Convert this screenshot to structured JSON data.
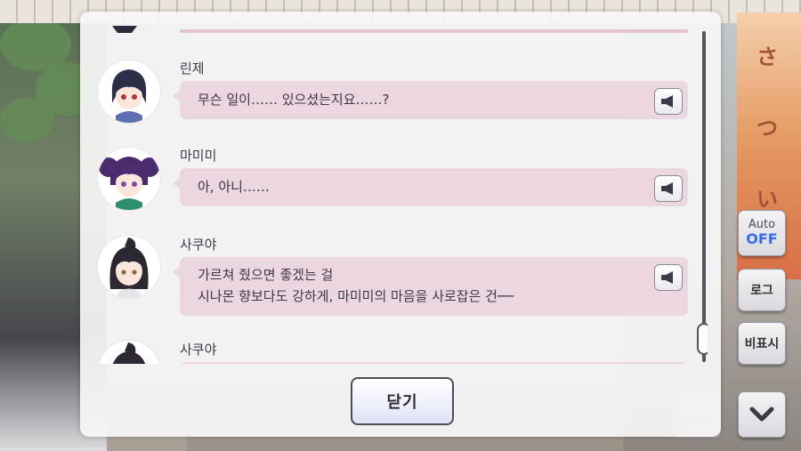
{
  "log": {
    "entries": [
      {
        "speaker": "린제",
        "lines": [
          "무슨 일이…… 있으셨는지요……?"
        ],
        "avatar_icon": "rinze-avatar"
      },
      {
        "speaker": "마미미",
        "lines": [
          "아, 아니……"
        ],
        "avatar_icon": "mamimi-avatar"
      },
      {
        "speaker": "사쿠야",
        "lines": [
          "가르쳐 줬으면 좋겠는 걸",
          "시나몬 향보다도 강하게, 마미미의 마음을 사로잡은 건──"
        ],
        "avatar_icon": "sakuya-avatar"
      },
      {
        "speaker": "사쿠야",
        "lines": [],
        "avatar_icon": "sakuya-avatar"
      }
    ],
    "voice_icon": "speaker-icon",
    "close_label": "닫기"
  },
  "controls": {
    "auto_label": "Auto",
    "auto_state": "OFF",
    "log_label": "로그",
    "hide_label": "비표시",
    "down_icon": "chevron-down-icon"
  },
  "colors": {
    "bubble": "#ecd7e1",
    "auto_off": "#3a6ee8",
    "dialog": "#f8f6f8"
  }
}
